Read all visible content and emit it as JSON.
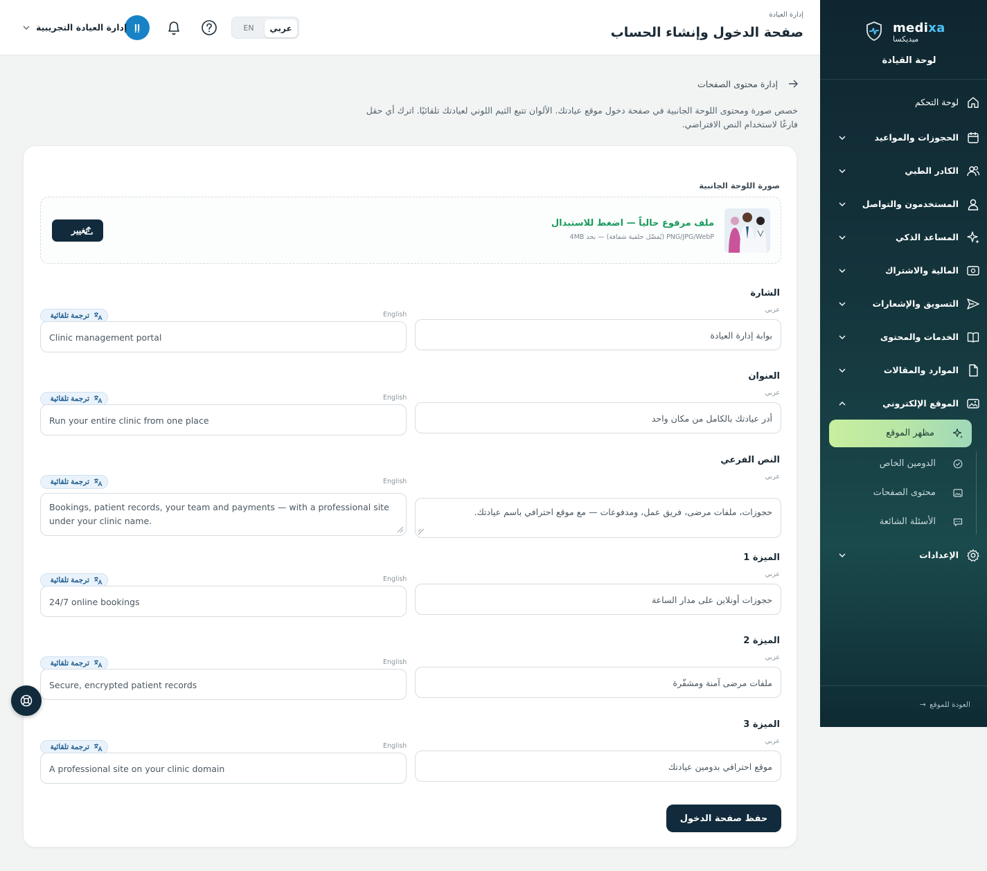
{
  "brand": {
    "name_main": "medi",
    "name_accent": "xa",
    "name_ar": "ميديكسا",
    "dashboard_title": "لوحة القيادة"
  },
  "nav": {
    "items": [
      {
        "label": "لوحة التحكم",
        "icon": "home-icon"
      },
      {
        "label": "الحجوزات والمواعيد",
        "icon": "calendar-icon"
      },
      {
        "label": "الكادر الطبي",
        "icon": "users-icon"
      },
      {
        "label": "المستخدمون والتواصل",
        "icon": "user-icon"
      },
      {
        "label": "المساعد الذكي",
        "icon": "sparkles-icon"
      },
      {
        "label": "المالية والاشتراك",
        "icon": "money-icon"
      },
      {
        "label": "التسويق والإشعارات",
        "icon": "send-icon"
      },
      {
        "label": "الخدمات والمحتوى",
        "icon": "book-icon"
      },
      {
        "label": "الموارد والمقالات",
        "icon": "file-icon"
      },
      {
        "label": "الموقع الإلكتروني",
        "icon": "image-icon"
      },
      {
        "label": "الإعدادات",
        "icon": "settings-icon"
      }
    ],
    "sub_items": [
      {
        "label": "مظهر الموقع",
        "icon": "sparkles-icon",
        "active": true
      },
      {
        "label": "الدومين الخاص",
        "icon": "check-circle-icon"
      },
      {
        "label": "محتوى الصفحات",
        "icon": "image-icon"
      },
      {
        "label": "الأسئلة الشائعة",
        "icon": "chat-icon"
      }
    ],
    "back_to_site": "العودة للموقع"
  },
  "header": {
    "breadcrumb": "إدارة العيادة",
    "title": "صفحة الدخول وإنشاء الحساب",
    "lang_ar": "عربي",
    "lang_en": "EN",
    "user_initials": "إإ",
    "user_name": "إدارة العيادة التجريبية"
  },
  "main": {
    "back_link": "إدارة محتوى الصفحات",
    "intro": "خصص صورة ومحتوى اللوحة الجانبية في صفحة دخول موقع عيادتك. الألوان تتبع الثيم اللوني لعيادتك تلقائيًا. اترك أي حقل فارغًا لاستخدام النص الافتراضي.",
    "image_label": "صورة اللوحة الجانبية",
    "upload_title": "ملف مرفوع حالياً — اضغط للاستبدال",
    "upload_hint": "PNG/JPG/WebP (يُفضّل خلفية شفافة) — بحد 4MB",
    "change_label": "تغيير",
    "auto_translate": "ترجمة تلقائية",
    "ar_sub": "عربي",
    "en_sub": "English",
    "fields": [
      {
        "title": "الشارة",
        "ar": "بوابة إدارة العيادة",
        "en": "Clinic management portal"
      },
      {
        "title": "العنوان",
        "ar": "أدر عيادتك بالكامل من مكان واحد",
        "en": "Run your entire clinic from one place"
      },
      {
        "title": "النص الفرعي",
        "ar": "حجوزات، ملفات مرضى، فريق عمل، ومدفوعات — مع موقع احترافي باسم عيادتك.",
        "en": "Bookings, patient records, your team and payments — with a professional site under your clinic name."
      },
      {
        "title": "الميزة 1",
        "ar": "حجوزات أونلاين على مدار الساعة",
        "en": "24/7 online bookings"
      },
      {
        "title": "الميزة 2",
        "ar": "ملفات مرضى آمنة ومشفّرة",
        "en": "Secure, encrypted patient records"
      },
      {
        "title": "الميزة 3",
        "ar": "موقع احترافي بدومين عيادتك",
        "en": "A professional site on your clinic domain"
      }
    ],
    "save_label": "حفظ صفحة الدخول"
  },
  "colors": {
    "sidebar": "#0f2630",
    "primary": "#112b3c",
    "accent_green": "#1a9b5e",
    "active_sub": "#c8ee9e",
    "avatar": "#1782c5"
  }
}
